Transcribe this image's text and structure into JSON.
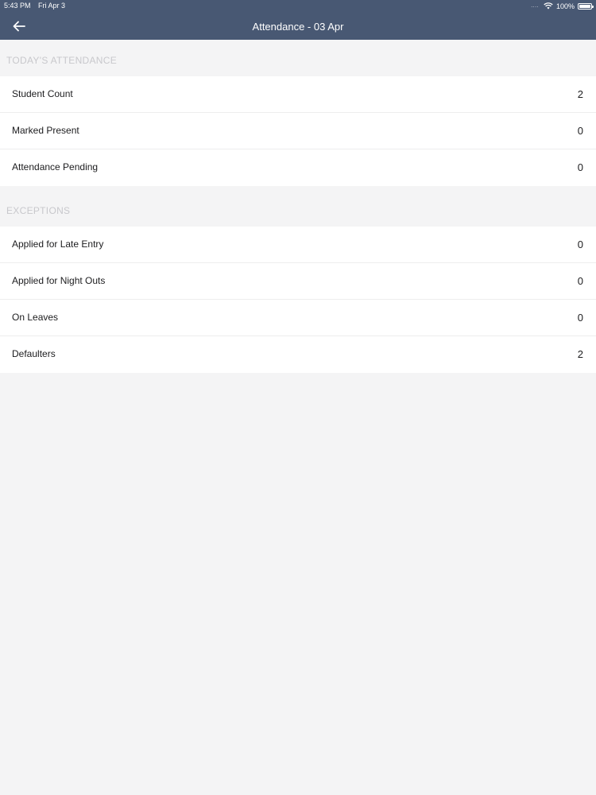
{
  "status_bar": {
    "time": "5:43 PM",
    "date": "Fri Apr 3",
    "signal": "....",
    "battery": "100%",
    "wifi_icon": "wifi-icon",
    "battery_icon": "battery-icon"
  },
  "nav": {
    "title": "Attendance - 03 Apr",
    "back_icon": "back-arrow-icon"
  },
  "sections": [
    {
      "header": "TODAY'S ATTENDANCE",
      "rows": [
        {
          "label": "Student Count",
          "value": "2"
        },
        {
          "label": "Marked Present",
          "value": "0"
        },
        {
          "label": "Attendance Pending",
          "value": "0"
        }
      ]
    },
    {
      "header": "EXCEPTIONS",
      "rows": [
        {
          "label": "Applied for Late Entry",
          "value": "0"
        },
        {
          "label": "Applied for Night Outs",
          "value": "0"
        },
        {
          "label": "On Leaves",
          "value": "0"
        },
        {
          "label": "Defaulters",
          "value": "2"
        }
      ]
    }
  ],
  "colors": {
    "header_bg": "#485873",
    "page_bg": "#f4f4f5",
    "section_header_text": "#c8c8cc"
  }
}
